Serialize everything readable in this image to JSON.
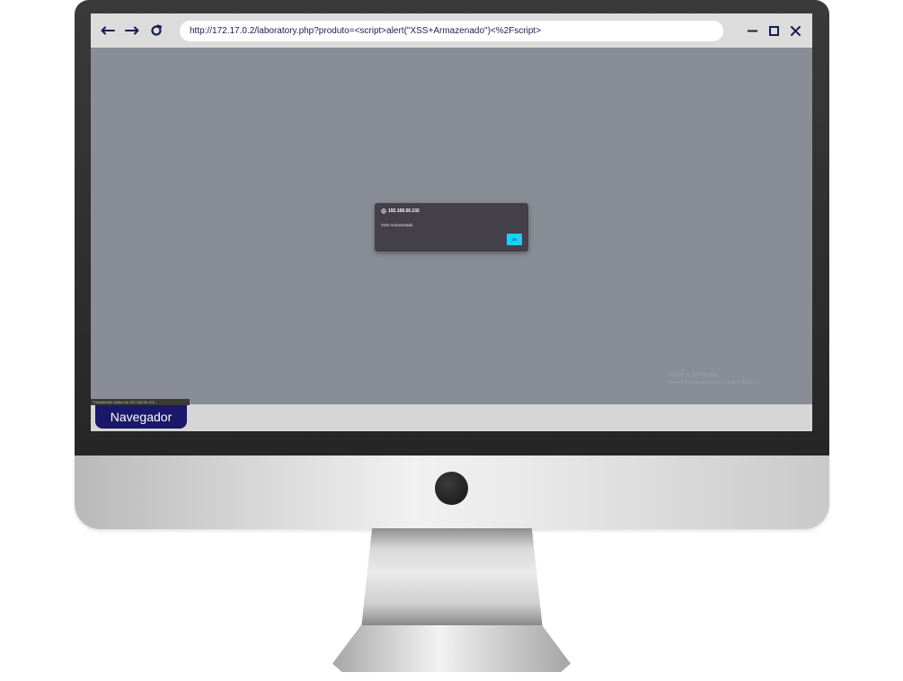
{
  "browser": {
    "url": "http://172.17.0.2/laboratory.php?produto=<script>alert(\"XSS+Armazenado\")<%2Fscript>",
    "nav_icons": [
      "arrow-left-icon",
      "arrow-right-icon",
      "reload-icon"
    ],
    "window_icons": [
      "minimize-icon",
      "maximize-icon",
      "close-icon"
    ],
    "status_text": "Transferindo dados de 192.168.56.102...",
    "tab_label": "Navegador"
  },
  "dialog": {
    "origin": "192.168.56.102",
    "message": "XSS Armazenado",
    "ok_label": "OK",
    "ok_color": "#1ad0f5"
  },
  "watermark": {
    "title": "Ativar o Windows",
    "subtitle": "Acesse Configurações para ativar o Windows."
  },
  "colors": {
    "nav_blue": "#141e4f",
    "tag_bg": "#1b1769",
    "page_overlay": "#898d95"
  }
}
